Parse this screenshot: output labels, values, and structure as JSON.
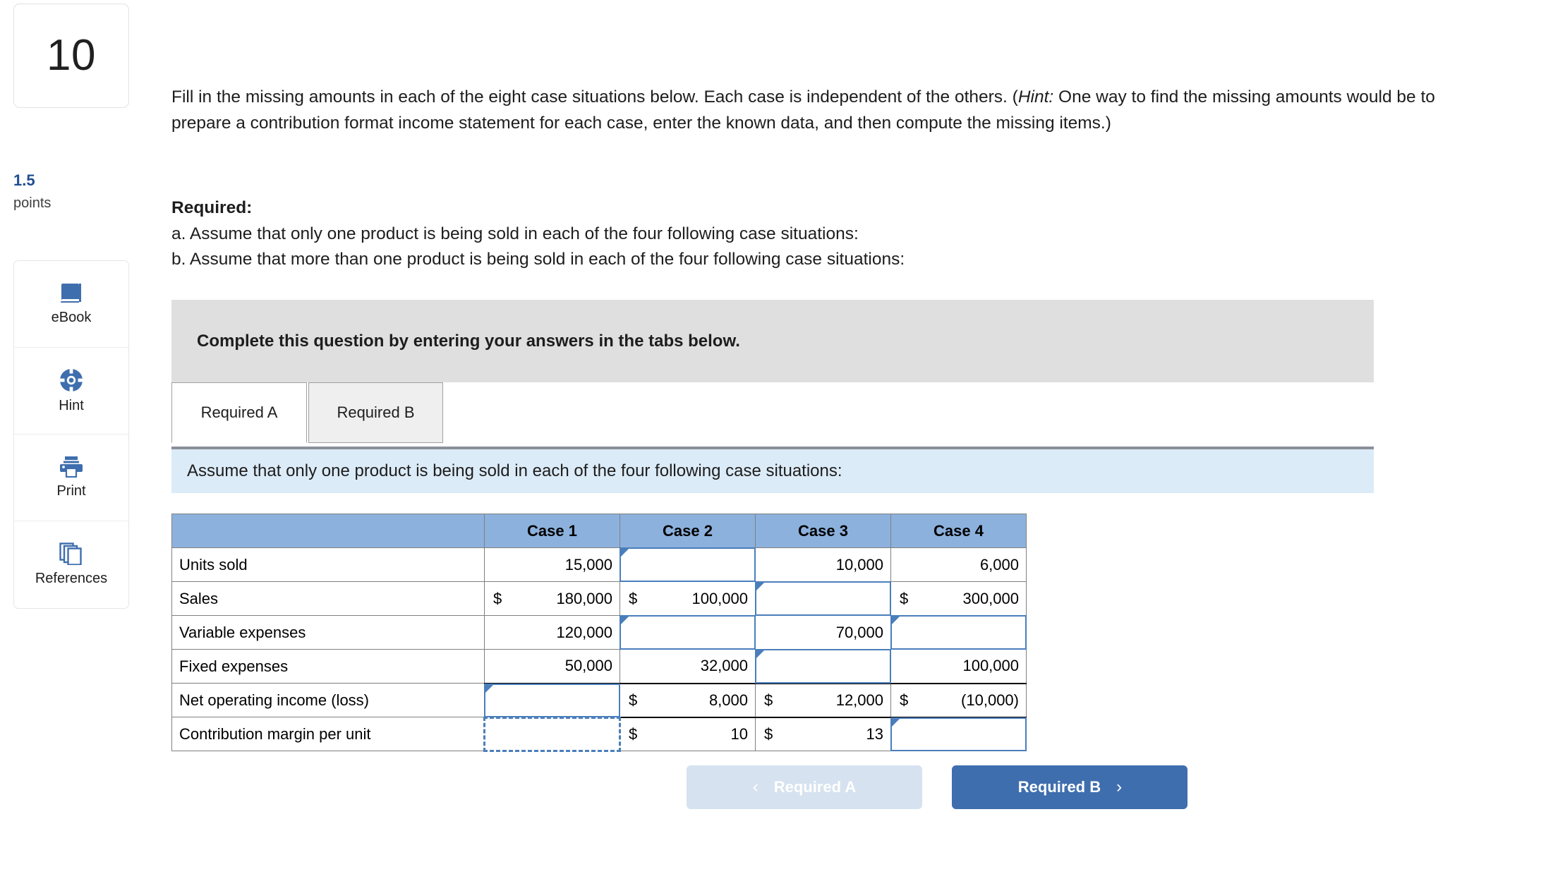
{
  "question": {
    "number": "10",
    "points_value": "1.5",
    "points_label": "points"
  },
  "tools": [
    {
      "label": "eBook",
      "icon": "book-icon"
    },
    {
      "label": "Hint",
      "icon": "life-ring-icon"
    },
    {
      "label": "Print",
      "icon": "printer-icon"
    },
    {
      "label": "References",
      "icon": "stacked-pages-icon"
    }
  ],
  "prompt": {
    "part1": "Fill in the missing amounts in each of the eight case situations below. Each case is independent of the others. (",
    "hint_word": "Hint:",
    "part2": " One way to find the missing amounts would be to prepare a contribution format income statement for each case, enter the known data, and then compute the missing items.)"
  },
  "required": {
    "heading": "Required:",
    "item_a": "a. Assume that only one product is being sold in each of the four following case situations:",
    "item_b": "b. Assume that more than one product is being sold in each of the four following case situations:"
  },
  "gray_banner": {
    "text": "Complete this question by entering your answers in the tabs below."
  },
  "tabs": [
    {
      "label": "Required A",
      "active": true
    },
    {
      "label": "Required B",
      "active": false
    }
  ],
  "blue_banner": {
    "text": "Assume that only one product is being sold in each of the four following case situations:"
  },
  "table": {
    "corner_header": "",
    "columns": [
      "Case 1",
      "Case 2",
      "Case 3",
      "Case 4"
    ],
    "rows": [
      {
        "label": "Units sold",
        "cells": [
          {
            "dollar": "",
            "value": "15,000",
            "input": false
          },
          {
            "dollar": "",
            "value": "",
            "input": true
          },
          {
            "dollar": "",
            "value": "10,000",
            "input": false
          },
          {
            "dollar": "",
            "value": "6,000",
            "input": false
          }
        ],
        "rule_after": false
      },
      {
        "label": "Sales",
        "cells": [
          {
            "dollar": "$",
            "value": "180,000",
            "input": false
          },
          {
            "dollar": "$",
            "value": "100,000",
            "input": false
          },
          {
            "dollar": "",
            "value": "",
            "input": true
          },
          {
            "dollar": "$",
            "value": "300,000",
            "input": false
          }
        ],
        "rule_after": false
      },
      {
        "label": "Variable expenses",
        "cells": [
          {
            "dollar": "",
            "value": "120,000",
            "input": false
          },
          {
            "dollar": "",
            "value": "",
            "input": true
          },
          {
            "dollar": "",
            "value": "70,000",
            "input": false
          },
          {
            "dollar": "",
            "value": "",
            "input": true
          }
        ],
        "rule_after": false
      },
      {
        "label": "Fixed expenses",
        "cells": [
          {
            "dollar": "",
            "value": "50,000",
            "input": false
          },
          {
            "dollar": "",
            "value": "32,000",
            "input": false
          },
          {
            "dollar": "",
            "value": "",
            "input": true
          },
          {
            "dollar": "",
            "value": "100,000",
            "input": false
          }
        ],
        "rule_after": true
      },
      {
        "label": "Net operating income (loss)",
        "cells": [
          {
            "dollar": "",
            "value": "",
            "input": true
          },
          {
            "dollar": "$",
            "value": "8,000",
            "input": false
          },
          {
            "dollar": "$",
            "value": "12,000",
            "input": false
          },
          {
            "dollar": "$",
            "value": "(10,000)",
            "input": false
          }
        ],
        "rule_after": true
      },
      {
        "label": "Contribution margin per unit",
        "cells": [
          {
            "dollar": "",
            "value": "",
            "input": true,
            "dotted": true
          },
          {
            "dollar": "$",
            "value": "10",
            "input": false
          },
          {
            "dollar": "$",
            "value": "13",
            "input": false
          },
          {
            "dollar": "",
            "value": "",
            "input": true
          }
        ],
        "rule_after": false
      }
    ]
  },
  "nav": {
    "prev_label": "Required A",
    "prev_chevron": "‹",
    "next_label": "Required B",
    "next_chevron": "›"
  },
  "colors": {
    "table_header_blue": "#8cb1dd",
    "input_border_blue": "#4a7ebb",
    "banner_gray": "#dfdfdf",
    "banner_blue": "#dcebf8",
    "accent_blue": "#3f6eae",
    "points_blue": "#1f4e91"
  }
}
